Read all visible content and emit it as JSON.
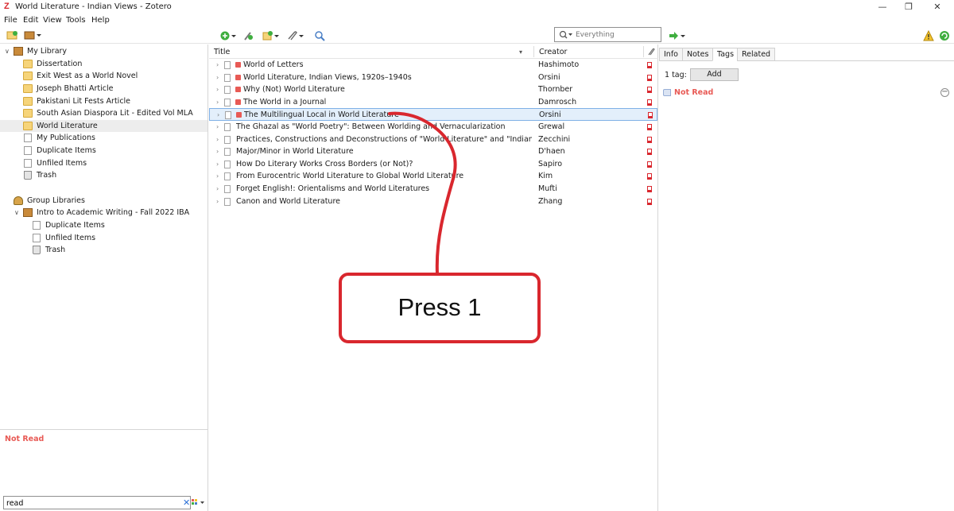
{
  "window": {
    "title": "World Literature - Indian Views - Zotero",
    "app_icon": "Z",
    "controls": {
      "minimize": "—",
      "restore": "❐",
      "close": "✕"
    }
  },
  "menu": [
    {
      "label": "File"
    },
    {
      "label": "Edit"
    },
    {
      "label": "View"
    },
    {
      "label": "Tools"
    },
    {
      "label": "Help"
    }
  ],
  "toolbar": {
    "search_placeholder": "Everything",
    "icons": [
      "new-collection-icon",
      "new-library-icon",
      "new-item-icon",
      "add-by-identifier-icon",
      "new-note-icon",
      "add-attachment-icon",
      "advanced-search-icon",
      "locate-icon",
      "sync-error-icon",
      "sync-icon"
    ]
  },
  "collections": {
    "my_library": "My Library",
    "items": [
      {
        "label": "Dissertation",
        "icon": "folder-icon"
      },
      {
        "label": "Exit West as a World Novel",
        "icon": "folder-icon"
      },
      {
        "label": "Joseph Bhatti Article",
        "icon": "folder-icon"
      },
      {
        "label": "Pakistani Lit Fests Article",
        "icon": "folder-icon"
      },
      {
        "label": "South Asian Diaspora Lit - Edited Vol MLA",
        "icon": "folder-icon"
      },
      {
        "label": "World Literature",
        "icon": "folder-icon",
        "selected": true
      },
      {
        "label": "My Publications",
        "icon": "publications-icon"
      },
      {
        "label": "Duplicate Items",
        "icon": "duplicate-icon"
      },
      {
        "label": "Unfiled Items",
        "icon": "unfiled-icon"
      },
      {
        "label": "Trash",
        "icon": "trash-icon"
      }
    ],
    "group_libraries": "Group Libraries",
    "group": {
      "label": "Intro to Academic Writing - Fall 2022 IBA",
      "children": [
        {
          "label": "Duplicate Items",
          "icon": "duplicate-icon"
        },
        {
          "label": "Unfiled Items",
          "icon": "unfiled-icon"
        },
        {
          "label": "Trash",
          "icon": "trash-icon"
        }
      ]
    }
  },
  "tag_selector": {
    "selected_tag": "Not Read",
    "filter_value": "read",
    "clear": "✕"
  },
  "items_table": {
    "columns": {
      "title": "Title",
      "creator": "Creator"
    },
    "rows": [
      {
        "title": "World of Letters",
        "creator": "Hashimoto",
        "tagged": true
      },
      {
        "title": "World Literature, Indian Views, 1920s–1940s",
        "creator": "Orsini",
        "tagged": true
      },
      {
        "title": "Why (Not) World Literature",
        "creator": "Thornber",
        "tagged": true
      },
      {
        "title": "The World in a Journal",
        "creator": "Damrosch",
        "tagged": true
      },
      {
        "title": "The Multilingual Local in World Literature",
        "creator": "Orsini",
        "tagged": true,
        "selected": true
      },
      {
        "title": "The Ghazal as \"World Poetry\": Between Worlding and Vernacularization",
        "creator": "Grewal",
        "tagged": false
      },
      {
        "title": "Practices, Constructions and Deconstructions of \"World Literature\" and \"Indian Literature...",
        "creator": "Zecchini",
        "tagged": false
      },
      {
        "title": "Major/Minor in World Literature",
        "creator": "D'haen",
        "tagged": false
      },
      {
        "title": "How Do Literary Works Cross Borders (or Not)?",
        "creator": "Sapiro",
        "tagged": false
      },
      {
        "title": "From Eurocentric World Literature to Global World Literature",
        "creator": "Kim",
        "tagged": false
      },
      {
        "title": "Forget English!: Orientalisms and World Literatures",
        "creator": "Mufti",
        "tagged": false
      },
      {
        "title": "Canon and World Literature",
        "creator": "Zhang",
        "tagged": false
      }
    ]
  },
  "item_pane": {
    "tabs": [
      {
        "label": "Info"
      },
      {
        "label": "Notes"
      },
      {
        "label": "Tags",
        "active": true
      },
      {
        "label": "Related"
      }
    ],
    "tag_count": "1 tag:",
    "add_label": "Add",
    "tags": [
      "Not Read"
    ]
  },
  "annotation": {
    "text": "Press 1",
    "color": "#d9272e"
  }
}
